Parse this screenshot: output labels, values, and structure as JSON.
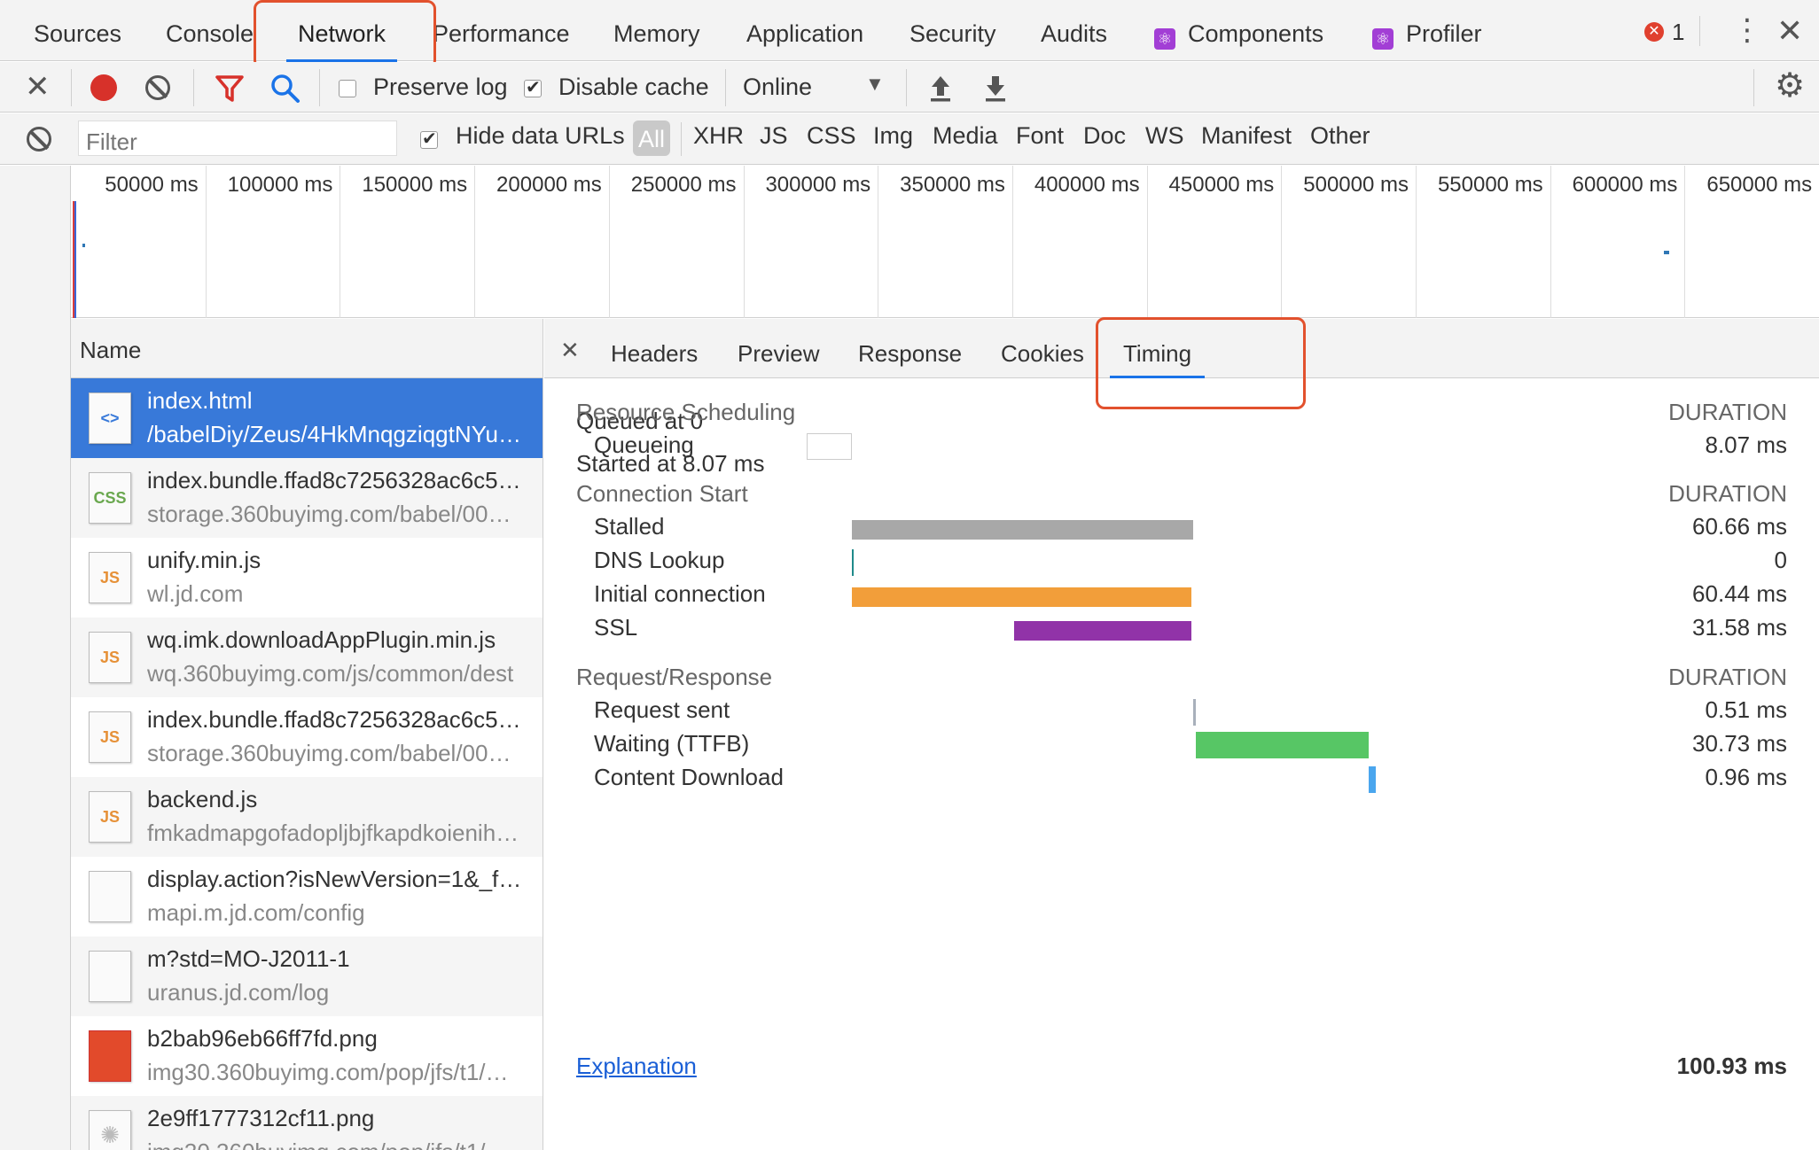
{
  "devtools_tabs": [
    "Sources",
    "Console",
    "Network",
    "Performance",
    "Memory",
    "Application",
    "Security",
    "Audits",
    "Components",
    "Profiler"
  ],
  "active_tab": "Network",
  "error_count": "1",
  "toolbar": {
    "preserve_log_label": "Preserve log",
    "preserve_log_checked": false,
    "disable_cache_label": "Disable cache",
    "disable_cache_checked": true,
    "throttle_value": "Online"
  },
  "filter": {
    "placeholder": "Filter",
    "hide_data_urls_label": "Hide data URLs",
    "hide_data_urls_checked": true,
    "types": [
      "All",
      "XHR",
      "JS",
      "CSS",
      "Img",
      "Media",
      "Font",
      "Doc",
      "WS",
      "Manifest",
      "Other"
    ],
    "active_type": "All"
  },
  "overview_ticks": [
    "50000 ms",
    "100000 ms",
    "150000 ms",
    "200000 ms",
    "250000 ms",
    "300000 ms",
    "350000 ms",
    "400000 ms",
    "450000 ms",
    "500000 ms",
    "550000 ms",
    "600000 ms",
    "650000 ms"
  ],
  "name_column_header": "Name",
  "requests": [
    {
      "name": "index.html",
      "sub": "/babelDiy/Zeus/4HkMnqgziqgtNYu…",
      "type": "html",
      "selected": true
    },
    {
      "name": "index.bundle.ffad8c7256328ac6c5…",
      "sub": "storage.360buyimg.com/babel/00…",
      "type": "css"
    },
    {
      "name": "unify.min.js",
      "sub": "wl.jd.com",
      "type": "js"
    },
    {
      "name": "wq.imk.downloadAppPlugin.min.js",
      "sub": "wq.360buyimg.com/js/common/dest",
      "type": "js"
    },
    {
      "name": "index.bundle.ffad8c7256328ac6c5…",
      "sub": "storage.360buyimg.com/babel/00…",
      "type": "js"
    },
    {
      "name": "backend.js",
      "sub": "fmkadmapgofadopljbjfkapdkoienih…",
      "type": "js"
    },
    {
      "name": "display.action?isNewVersion=1&_f…",
      "sub": "mapi.m.jd.com/config",
      "type": "blank"
    },
    {
      "name": "m?std=MO-J2011-1",
      "sub": "uranus.jd.com/log",
      "type": "blank"
    },
    {
      "name": "b2bab96eb66ff7fd.png",
      "sub": "img30.360buyimg.com/pop/jfs/t1/…",
      "type": "img"
    },
    {
      "name": "2e9ff1777312cf11.png",
      "sub": "img30.360buyimg.com/pop/jfs/t1/…",
      "type": "loading"
    }
  ],
  "icon_labels": {
    "css": "CSS",
    "js": "JS",
    "html": "<>"
  },
  "detail_tabs": [
    "Headers",
    "Preview",
    "Response",
    "Cookies",
    "Timing"
  ],
  "active_detail_tab": "Timing",
  "timing": {
    "queued_at": "Queued at 0",
    "started_at": "Started at 8.07 ms",
    "duration_label": "DURATION",
    "sections": [
      {
        "title": "Resource Scheduling",
        "rows": [
          {
            "label": "Queueing",
            "value": "8.07 ms",
            "start_ms": 0,
            "end_ms": 8.07,
            "color": "#ffffff"
          }
        ]
      },
      {
        "title": "Connection Start",
        "rows": [
          {
            "label": "Stalled",
            "value": "60.66 ms",
            "start_ms": 8.07,
            "end_ms": 68.73,
            "color": "#a8a8a8"
          },
          {
            "label": "DNS Lookup",
            "value": "0",
            "start_ms": 8.07,
            "end_ms": 8.07,
            "color": "#1f8a8a"
          },
          {
            "label": "Initial connection",
            "value": "60.44 ms",
            "start_ms": 8.07,
            "end_ms": 68.51,
            "color": "#f29e3a"
          },
          {
            "label": "SSL",
            "value": "31.58 ms",
            "start_ms": 36.93,
            "end_ms": 68.51,
            "color": "#9133a8"
          }
        ]
      },
      {
        "title": "Request/Response",
        "rows": [
          {
            "label": "Request sent",
            "value": "0.51 ms",
            "start_ms": 68.73,
            "end_ms": 69.24,
            "color": "#a8b0bb"
          },
          {
            "label": "Waiting (TTFB)",
            "value": "30.73 ms",
            "start_ms": 69.24,
            "end_ms": 99.97,
            "color": "#57c665"
          },
          {
            "label": "Content Download",
            "value": "0.96 ms",
            "start_ms": 99.97,
            "end_ms": 100.93,
            "color": "#4aa6ee"
          }
        ]
      }
    ],
    "explanation_label": "Explanation",
    "total": "100.93 ms"
  }
}
